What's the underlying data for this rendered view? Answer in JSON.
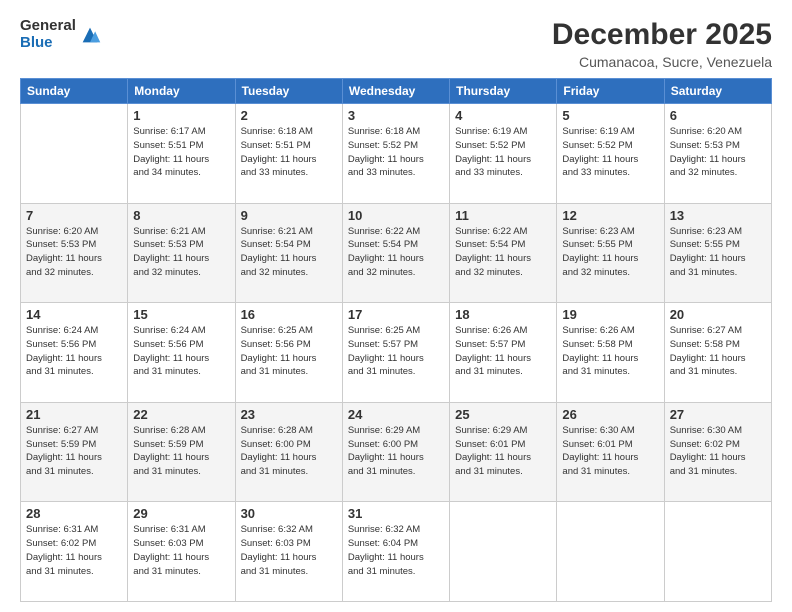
{
  "header": {
    "logo_general": "General",
    "logo_blue": "Blue",
    "month_title": "December 2025",
    "location": "Cumanacoa, Sucre, Venezuela"
  },
  "days_of_week": [
    "Sunday",
    "Monday",
    "Tuesday",
    "Wednesday",
    "Thursday",
    "Friday",
    "Saturday"
  ],
  "weeks": [
    [
      {
        "day": "",
        "info": ""
      },
      {
        "day": "1",
        "info": "Sunrise: 6:17 AM\nSunset: 5:51 PM\nDaylight: 11 hours\nand 34 minutes."
      },
      {
        "day": "2",
        "info": "Sunrise: 6:18 AM\nSunset: 5:51 PM\nDaylight: 11 hours\nand 33 minutes."
      },
      {
        "day": "3",
        "info": "Sunrise: 6:18 AM\nSunset: 5:52 PM\nDaylight: 11 hours\nand 33 minutes."
      },
      {
        "day": "4",
        "info": "Sunrise: 6:19 AM\nSunset: 5:52 PM\nDaylight: 11 hours\nand 33 minutes."
      },
      {
        "day": "5",
        "info": "Sunrise: 6:19 AM\nSunset: 5:52 PM\nDaylight: 11 hours\nand 33 minutes."
      },
      {
        "day": "6",
        "info": "Sunrise: 6:20 AM\nSunset: 5:53 PM\nDaylight: 11 hours\nand 32 minutes."
      }
    ],
    [
      {
        "day": "7",
        "info": "Sunrise: 6:20 AM\nSunset: 5:53 PM\nDaylight: 11 hours\nand 32 minutes."
      },
      {
        "day": "8",
        "info": "Sunrise: 6:21 AM\nSunset: 5:53 PM\nDaylight: 11 hours\nand 32 minutes."
      },
      {
        "day": "9",
        "info": "Sunrise: 6:21 AM\nSunset: 5:54 PM\nDaylight: 11 hours\nand 32 minutes."
      },
      {
        "day": "10",
        "info": "Sunrise: 6:22 AM\nSunset: 5:54 PM\nDaylight: 11 hours\nand 32 minutes."
      },
      {
        "day": "11",
        "info": "Sunrise: 6:22 AM\nSunset: 5:54 PM\nDaylight: 11 hours\nand 32 minutes."
      },
      {
        "day": "12",
        "info": "Sunrise: 6:23 AM\nSunset: 5:55 PM\nDaylight: 11 hours\nand 32 minutes."
      },
      {
        "day": "13",
        "info": "Sunrise: 6:23 AM\nSunset: 5:55 PM\nDaylight: 11 hours\nand 31 minutes."
      }
    ],
    [
      {
        "day": "14",
        "info": "Sunrise: 6:24 AM\nSunset: 5:56 PM\nDaylight: 11 hours\nand 31 minutes."
      },
      {
        "day": "15",
        "info": "Sunrise: 6:24 AM\nSunset: 5:56 PM\nDaylight: 11 hours\nand 31 minutes."
      },
      {
        "day": "16",
        "info": "Sunrise: 6:25 AM\nSunset: 5:56 PM\nDaylight: 11 hours\nand 31 minutes."
      },
      {
        "day": "17",
        "info": "Sunrise: 6:25 AM\nSunset: 5:57 PM\nDaylight: 11 hours\nand 31 minutes."
      },
      {
        "day": "18",
        "info": "Sunrise: 6:26 AM\nSunset: 5:57 PM\nDaylight: 11 hours\nand 31 minutes."
      },
      {
        "day": "19",
        "info": "Sunrise: 6:26 AM\nSunset: 5:58 PM\nDaylight: 11 hours\nand 31 minutes."
      },
      {
        "day": "20",
        "info": "Sunrise: 6:27 AM\nSunset: 5:58 PM\nDaylight: 11 hours\nand 31 minutes."
      }
    ],
    [
      {
        "day": "21",
        "info": "Sunrise: 6:27 AM\nSunset: 5:59 PM\nDaylight: 11 hours\nand 31 minutes."
      },
      {
        "day": "22",
        "info": "Sunrise: 6:28 AM\nSunset: 5:59 PM\nDaylight: 11 hours\nand 31 minutes."
      },
      {
        "day": "23",
        "info": "Sunrise: 6:28 AM\nSunset: 6:00 PM\nDaylight: 11 hours\nand 31 minutes."
      },
      {
        "day": "24",
        "info": "Sunrise: 6:29 AM\nSunset: 6:00 PM\nDaylight: 11 hours\nand 31 minutes."
      },
      {
        "day": "25",
        "info": "Sunrise: 6:29 AM\nSunset: 6:01 PM\nDaylight: 11 hours\nand 31 minutes."
      },
      {
        "day": "26",
        "info": "Sunrise: 6:30 AM\nSunset: 6:01 PM\nDaylight: 11 hours\nand 31 minutes."
      },
      {
        "day": "27",
        "info": "Sunrise: 6:30 AM\nSunset: 6:02 PM\nDaylight: 11 hours\nand 31 minutes."
      }
    ],
    [
      {
        "day": "28",
        "info": "Sunrise: 6:31 AM\nSunset: 6:02 PM\nDaylight: 11 hours\nand 31 minutes."
      },
      {
        "day": "29",
        "info": "Sunrise: 6:31 AM\nSunset: 6:03 PM\nDaylight: 11 hours\nand 31 minutes."
      },
      {
        "day": "30",
        "info": "Sunrise: 6:32 AM\nSunset: 6:03 PM\nDaylight: 11 hours\nand 31 minutes."
      },
      {
        "day": "31",
        "info": "Sunrise: 6:32 AM\nSunset: 6:04 PM\nDaylight: 11 hours\nand 31 minutes."
      },
      {
        "day": "",
        "info": ""
      },
      {
        "day": "",
        "info": ""
      },
      {
        "day": "",
        "info": ""
      }
    ]
  ]
}
